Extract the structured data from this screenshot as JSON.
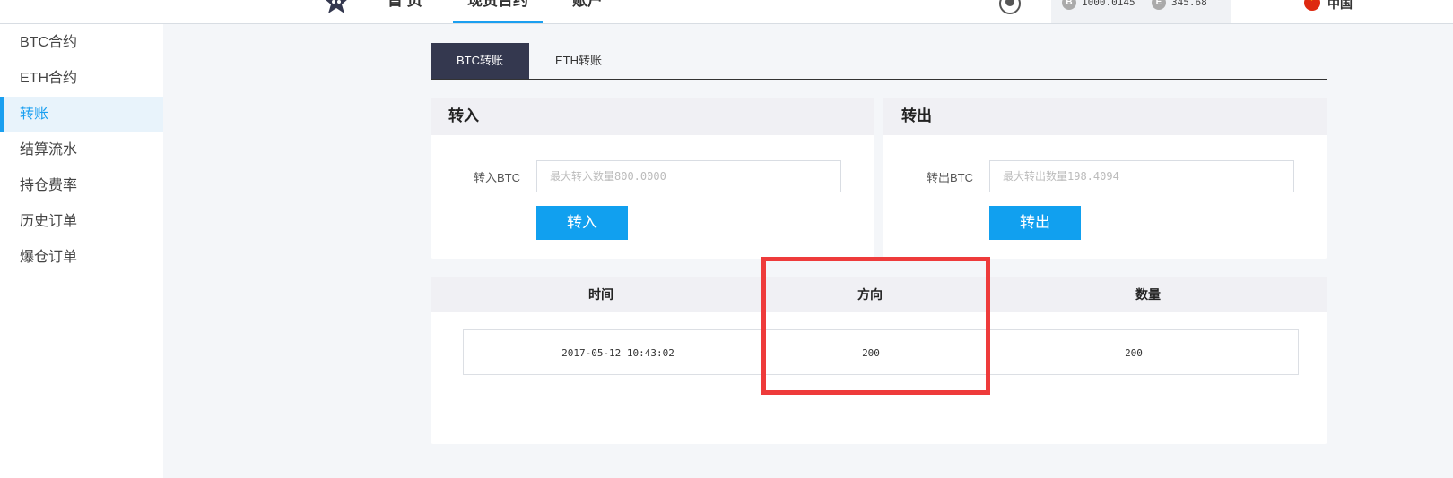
{
  "header": {
    "nav": [
      {
        "label": "首 页"
      },
      {
        "label": "现货合约"
      },
      {
        "label": "账户"
      }
    ],
    "balances": [
      {
        "symbol": "B",
        "value": "1000.0145"
      },
      {
        "symbol": "E",
        "value": "345.68"
      }
    ],
    "language": "中国"
  },
  "sidebar": {
    "items": [
      {
        "label": "BTC合约"
      },
      {
        "label": "ETH合约"
      },
      {
        "label": "转账"
      },
      {
        "label": "结算流水"
      },
      {
        "label": "持仓费率"
      },
      {
        "label": "历史订单"
      },
      {
        "label": "爆仓订单"
      }
    ]
  },
  "tabs": [
    {
      "label": "BTC转账"
    },
    {
      "label": "ETH转账"
    }
  ],
  "transfer_in": {
    "title": "转入",
    "field_label": "转入BTC",
    "placeholder": "最大转入数量800.0000",
    "value": "",
    "button": "转入"
  },
  "transfer_out": {
    "title": "转出",
    "field_label": "转出BTC",
    "placeholder": "最大转出数量198.4094",
    "value": "",
    "button": "转出"
  },
  "records": {
    "columns": [
      "时间",
      "方向",
      "数量"
    ],
    "rows": [
      [
        "2017-05-12 10:43:02",
        "200",
        "200"
      ]
    ]
  },
  "colors": {
    "accent": "#11a0ef",
    "tab_active": "#34384f",
    "highlight": "#ee3b3b"
  }
}
